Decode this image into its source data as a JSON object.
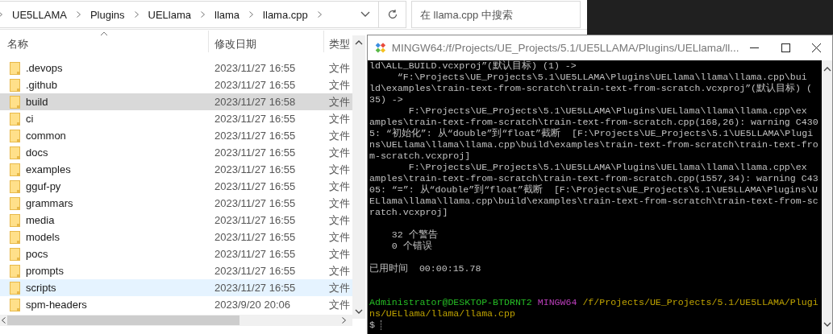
{
  "explorer": {
    "breadcrumb": [
      "UE5LLAMA",
      "Plugins",
      "UELlama",
      "llama",
      "llama.cpp"
    ],
    "search": {
      "placeholder": "在 llama.cpp 中搜索"
    },
    "columns": [
      {
        "label": "名称",
        "sorted": true
      },
      {
        "label": "修改日期",
        "sorted": false
      },
      {
        "label": "类型",
        "sorted": false
      }
    ],
    "rows": [
      {
        "name": ".devops",
        "modified": "2023/11/27 16:55",
        "type": "文件",
        "selected": false,
        "hovered": false
      },
      {
        "name": ".github",
        "modified": "2023/11/27 16:55",
        "type": "文件",
        "selected": false,
        "hovered": false
      },
      {
        "name": "build",
        "modified": "2023/11/27 16:58",
        "type": "文件",
        "selected": true,
        "hovered": false
      },
      {
        "name": "ci",
        "modified": "2023/11/27 16:55",
        "type": "文件",
        "selected": false,
        "hovered": false
      },
      {
        "name": "common",
        "modified": "2023/11/27 16:55",
        "type": "文件",
        "selected": false,
        "hovered": false
      },
      {
        "name": "docs",
        "modified": "2023/11/27 16:55",
        "type": "文件",
        "selected": false,
        "hovered": false
      },
      {
        "name": "examples",
        "modified": "2023/11/27 16:55",
        "type": "文件",
        "selected": false,
        "hovered": false
      },
      {
        "name": "gguf-py",
        "modified": "2023/11/27 16:55",
        "type": "文件",
        "selected": false,
        "hovered": false
      },
      {
        "name": "grammars",
        "modified": "2023/11/27 16:55",
        "type": "文件",
        "selected": false,
        "hovered": false
      },
      {
        "name": "media",
        "modified": "2023/11/27 16:55",
        "type": "文件",
        "selected": false,
        "hovered": false
      },
      {
        "name": "models",
        "modified": "2023/11/27 16:55",
        "type": "文件",
        "selected": false,
        "hovered": false
      },
      {
        "name": "pocs",
        "modified": "2023/11/27 16:55",
        "type": "文件",
        "selected": false,
        "hovered": false
      },
      {
        "name": "prompts",
        "modified": "2023/11/27 16:55",
        "type": "文件",
        "selected": false,
        "hovered": false
      },
      {
        "name": "scripts",
        "modified": "2023/11/27 16:55",
        "type": "文件",
        "selected": false,
        "hovered": true
      },
      {
        "name": "spm-headers",
        "modified": "2023/9/20 20:06",
        "type": "文件",
        "selected": false,
        "hovered": false
      }
    ]
  },
  "terminal": {
    "title": "MINGW64:/f/Projects/UE_Projects/5.1/UE5LLAMA/Plugins/UELlama/ll...",
    "blocks": [
      [
        "ld\\ALL_BUILD.vcxproj”(默认目标) (1) ->",
        "     “F:\\Projects\\UE_Projects\\5.1\\UE5LLAMA\\Plugins\\UELlama\\llama\\llama.cpp\\bui",
        "ld\\examples\\train-text-from-scratch\\train-text-from-scratch.vcxproj”(默认目标) (",
        "35) ->",
        "       F:\\Projects\\UE_Projects\\5.1\\UE5LLAMA\\Plugins\\UELlama\\llama\\llama.cpp\\ex",
        "amples\\train-text-from-scratch\\train-text-from-scratch.cpp(168,26): warning C430",
        "5: “初始化”: 从“double”到“float”截断  [F:\\Projects\\UE_Projects\\5.1\\UE5LLAMA\\Plugi",
        "ns\\UELlama\\llama\\llama.cpp\\build\\examples\\train-text-from-scratch\\train-text-fro",
        "m-scratch.vcxproj]",
        "       F:\\Projects\\UE_Projects\\5.1\\UE5LLAMA\\Plugins\\UELlama\\llama\\llama.cpp\\ex",
        "amples\\train-text-from-scratch\\train-text-from-scratch.cpp(1557,34): warning C43",
        "05: “=”: 从“double”到“float”截断  [F:\\Projects\\UE_Projects\\5.1\\UE5LLAMA\\Plugins\\U",
        "ELlama\\llama\\llama.cpp\\build\\examples\\train-text-from-scratch\\train-text-from-sc",
        "ratch.vcxproj]"
      ],
      [
        "    32 个警告",
        "    0 个错误"
      ],
      [
        "已用时间  00:00:15.78"
      ]
    ],
    "prompt": [
      {
        "text": "Administrator@DESKTOP-BTDRNT2",
        "color": "#25bc24"
      },
      {
        "text": "MINGW64",
        "color": "#bc3fbc"
      },
      {
        "text": "/f/Projects/UE_Projects/5.1/UE5LLAMA/Plugins/UELlama/llama/llama.cpp",
        "color": "#bfa300"
      }
    ],
    "input_prompt": "$"
  }
}
